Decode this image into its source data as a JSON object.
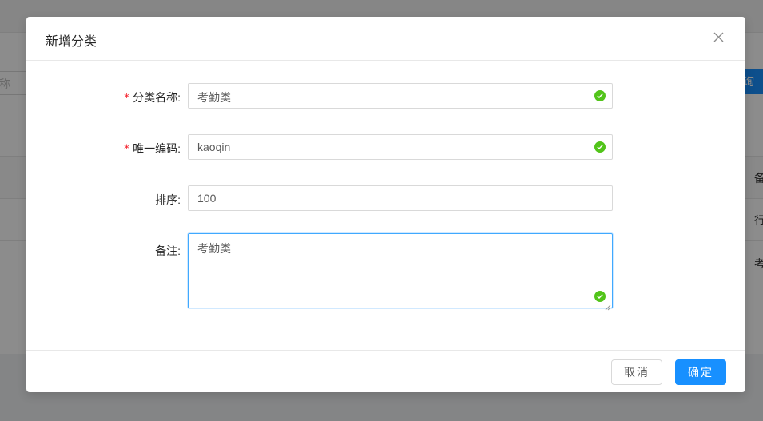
{
  "background": {
    "search_placeholder": "称",
    "query_button": "询",
    "table_header_cell": "备",
    "row_cells": [
      "行",
      "考"
    ]
  },
  "modal": {
    "title": "新增分类",
    "close_icon": "close-icon",
    "fields": {
      "category_name": {
        "label": "分类名称:",
        "required": true,
        "value": "考勤类",
        "valid": true
      },
      "unique_code": {
        "label": "唯一编码:",
        "required": true,
        "value": "kaoqin",
        "valid": true
      },
      "sort": {
        "label": "排序:",
        "required": false,
        "value": "100"
      },
      "remark": {
        "label": "备注:",
        "required": false,
        "value": "考勤类",
        "valid": true
      }
    },
    "footer": {
      "cancel_label": "取消",
      "ok_label": "确定"
    }
  },
  "colors": {
    "primary": "#1890ff",
    "success": "#52c41a",
    "required": "#f5222d"
  }
}
